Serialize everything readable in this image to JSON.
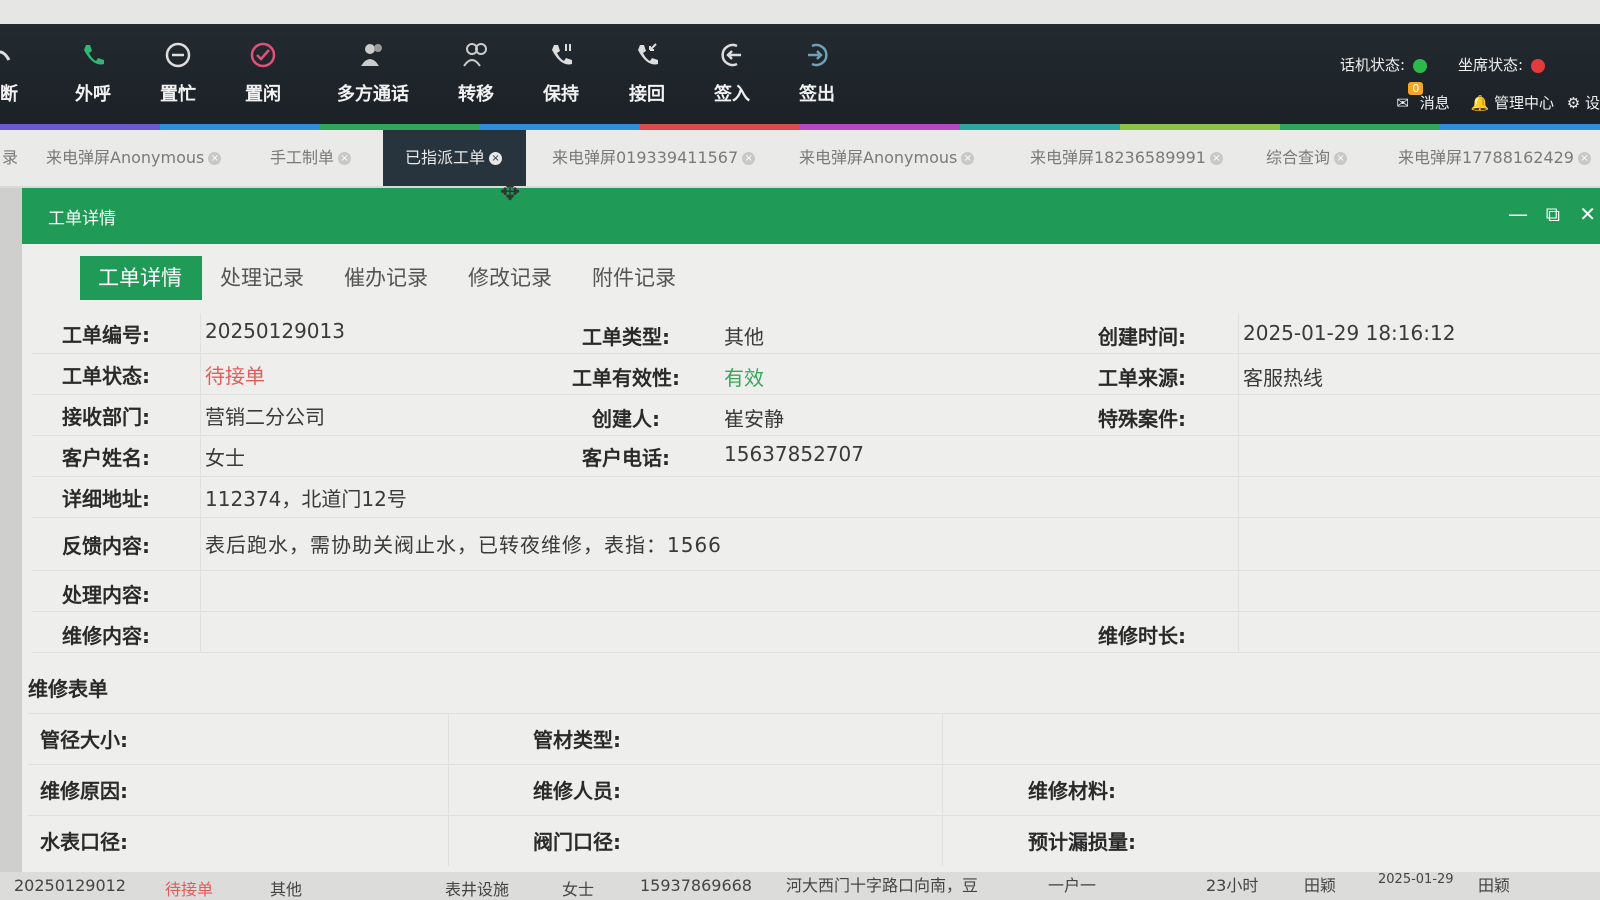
{
  "toolbar": {
    "buttons": [
      {
        "label": "挂断",
        "icon": "hangup-icon"
      },
      {
        "label": "外呼",
        "icon": "phone-icon"
      },
      {
        "label": "置忙",
        "icon": "busy-icon"
      },
      {
        "label": "置闲",
        "icon": "idle-icon"
      },
      {
        "label": "多方通话",
        "icon": "conference-icon"
      },
      {
        "label": "转移",
        "icon": "transfer-icon"
      },
      {
        "label": "保持",
        "icon": "hold-icon"
      },
      {
        "label": "接回",
        "icon": "retrieve-icon"
      },
      {
        "label": "签入",
        "icon": "sign-in-icon"
      },
      {
        "label": "签出",
        "icon": "sign-out-icon"
      }
    ],
    "phone_status_label": "话机状态:",
    "seat_status_label": "坐席状态:",
    "message_label": "消息",
    "message_count": "0",
    "admin_label": "管理中心",
    "settings_label": "设"
  },
  "tabs": [
    {
      "label": "来电弹屏Anonymous"
    },
    {
      "label": "手工制单"
    },
    {
      "label": "已指派工单"
    },
    {
      "label": "来电弹屏019339411567"
    },
    {
      "label": "来电弹屏Anonymous"
    },
    {
      "label": "来电弹屏18236589991"
    },
    {
      "label": "综合查询"
    },
    {
      "label": "来电弹屏17788162429"
    }
  ],
  "dialog": {
    "title": "工单详情",
    "subtabs": [
      "工单详情",
      "处理记录",
      "催办记录",
      "修改记录",
      "附件记录"
    ]
  },
  "details": {
    "order_no_label": "工单编号:",
    "order_no": "20250129013",
    "type_label": "工单类型:",
    "type": "其他",
    "created_label": "创建时间:",
    "created": "2025-01-29 18:16:12",
    "status_label": "工单状态:",
    "status": "待接单",
    "validity_label": "工单有效性:",
    "validity": "有效",
    "source_label": "工单来源:",
    "source": "客服热线",
    "dept_label": "接收部门:",
    "dept": "营销二分公司",
    "creator_label": "创建人:",
    "creator": "崔安静",
    "special_label": "特殊案件:",
    "customer_label": "客户姓名:",
    "customer": "女士",
    "phone_label": "客户电话:",
    "phone": "15637852707",
    "address_label": "详细地址:",
    "address": "112374，北道门12号",
    "feedback_label": "反馈内容:",
    "feedback": "表后跑水，需协助关阀止水，已转夜维修，表指：1566",
    "handling_label": "处理内容:",
    "repair_label": "维修内容:",
    "duration_label": "维修时长:"
  },
  "repair_form": {
    "title": "维修表单",
    "pipe_size_label": "管径大小:",
    "pipe_type_label": "管材类型:",
    "reason_label": "维修原因:",
    "worker_label": "维修人员:",
    "material_label": "维修材料:",
    "meter_label": "水表口径:",
    "valve_label": "阀门口径:",
    "leak_label": "预计漏损量:"
  },
  "background_row": {
    "no": "20250129012",
    "status": "待接单",
    "type": "其他",
    "dept": "表井设施",
    "name": "女士",
    "phone": "15937869668",
    "address": "河大西门十字路口向南，豆",
    "household": "一户一",
    "hours": "23小时",
    "person1": "田颖",
    "date": "2025-01-29",
    "person2": "田颖"
  },
  "colors": {
    "accent_green": "#1f9a57",
    "toolbar_bg": "#1b2126",
    "status_red": "#e25c5c",
    "valid_green": "#3aa55d"
  }
}
